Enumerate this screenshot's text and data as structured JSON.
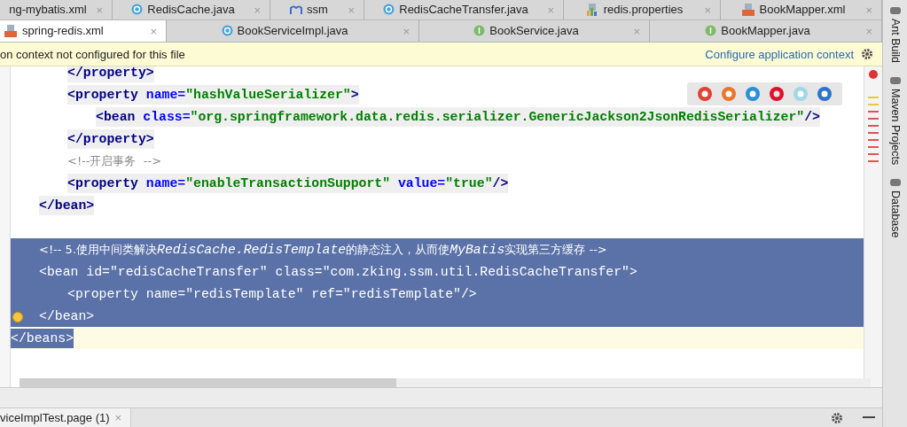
{
  "tab_rows": [
    [
      {
        "label": "ng-mybatis.xml",
        "kind": "plain",
        "close": "×",
        "selected": false
      },
      {
        "label": "RedisCache.java",
        "kind": "class",
        "close": "×",
        "selected": false
      },
      {
        "label": "ssm",
        "kind": "maven",
        "close": "×",
        "selected": false
      },
      {
        "label": "RedisCacheTransfer.java",
        "kind": "class",
        "close": "×",
        "selected": false
      },
      {
        "label": "redis.properties",
        "kind": "properties",
        "close": "×",
        "selected": false
      },
      {
        "label": "BookMapper.xml",
        "kind": "xml",
        "close": "×",
        "selected": false
      }
    ],
    [
      {
        "label": "spring-redis.xml",
        "kind": "xml",
        "close": "×",
        "selected": true
      },
      {
        "label": "BookServiceImpl.java",
        "kind": "class",
        "close": "×",
        "selected": false
      },
      {
        "label": "BookService.java",
        "kind": "interface",
        "close": "×",
        "selected": false
      },
      {
        "label": "BookMapper.java",
        "kind": "interface",
        "close": "×",
        "selected": false
      }
    ]
  ],
  "banner": {
    "message": "on context not configured for this file",
    "link": "Configure application context"
  },
  "code_lines": [
    {
      "children": [
        {
          "children": [
            {
              "selected": false,
              "current": false,
              "matched": true,
              "tokens": [
                {
                  "kind": "tag",
                  "text": "</property>"
                }
              ]
            },
            {
              "selected": false,
              "current": false,
              "matched": true,
              "tokens": [
                {
                  "kind": "tag",
                  "text": "<property "
                },
                {
                  "kind": "attr",
                  "text": "name="
                },
                {
                  "kind": "value",
                  "text": "\"hashValueSerializer\""
                },
                {
                  "kind": "tag",
                  "text": ">"
                }
              ],
              "children": [
                {
                  "selected": false,
                  "current": false,
                  "matched": true,
                  "tokens": [
                    {
                      "kind": "tag",
                      "text": "<bean "
                    },
                    {
                      "kind": "attr",
                      "text": "class="
                    },
                    {
                      "kind": "value",
                      "text": "\"org.springframework.data.redis.serializer.GenericJackson2JsonRedisSerializer\""
                    },
                    {
                      "kind": "tag",
                      "text": "/>"
                    }
                  ]
                }
              ]
            },
            {
              "selected": false,
              "current": false,
              "matched": true,
              "tokens": [
                {
                  "kind": "tag",
                  "text": "</property>"
                }
              ]
            },
            {
              "selected": false,
              "current": false,
              "matched": false,
              "tokens": [
                {
                  "kind": "comment",
                  "text": "<!--开启事务  -->"
                }
              ]
            },
            {
              "selected": false,
              "current": false,
              "matched": true,
              "tokens": [
                {
                  "kind": "tag",
                  "text": "<property "
                },
                {
                  "kind": "attr",
                  "text": "name="
                },
                {
                  "kind": "value",
                  "text": "\"enableTransactionSupport\" "
                },
                {
                  "kind": "attr",
                  "text": "value="
                },
                {
                  "kind": "value",
                  "text": "\"true\""
                },
                {
                  "kind": "tag",
                  "text": "/>"
                }
              ]
            }
          ]
        },
        {
          "selected": false,
          "current": false,
          "matched": true,
          "tokens": [
            {
              "kind": "tag",
              "text": "</bean>"
            }
          ]
        },
        {
          "selected": false,
          "current": false
        },
        {
          "selected": true,
          "current": false,
          "tokens": [
            {
              "kind": "comment",
              "text": "<!-- 5.使用中间类解决"
            },
            {
              "kind": "comment_italic",
              "text": "RedisCache.RedisTemplate"
            },
            {
              "kind": "comment",
              "text": "的静态注入，从而使"
            },
            {
              "kind": "comment_italic",
              "text": "MyBatis"
            },
            {
              "kind": "comment",
              "text": "实现第三方缓存 -->"
            }
          ]
        },
        {
          "selected": true,
          "current": false,
          "tokens": [
            {
              "kind": "tag",
              "text": "<bean id=\"redisCacheTransfer\" class=\"com.zking.ssm.util.RedisCacheTransfer\">"
            }
          ],
          "children": [
            {
              "selected": true,
              "current": false,
              "tokens": [
                {
                  "kind": "tag",
                  "text": "<property name=\"redisTemplate\" ref=\"redisTemplate\"/>"
                }
              ]
            }
          ]
        },
        {
          "selected": true,
          "current": false,
          "bulb": true,
          "tokens": [
            {
              "kind": "tag",
              "text": "</bean>"
            }
          ]
        }
      ]
    },
    {
      "selected": true,
      "current": true,
      "tokens": [
        {
          "kind": "tag",
          "text": "</beans>"
        }
      ]
    }
  ],
  "tool_windows": [
    "Ant Build",
    "Maven Projects",
    "Database"
  ],
  "bottom_tab": {
    "label": "viceImplTest.page (1)",
    "close": "×"
  }
}
